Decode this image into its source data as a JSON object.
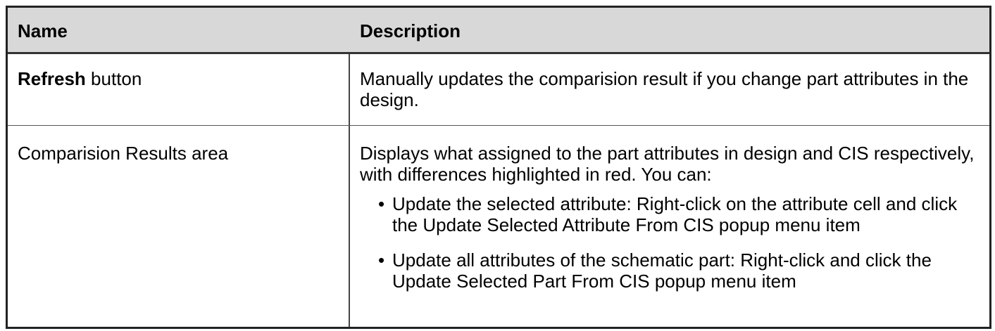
{
  "table": {
    "header": {
      "name": "Name",
      "description": "Description"
    },
    "rows": [
      {
        "name_bold": "Refresh",
        "name_rest": " button",
        "description": "Manually updates the comparision result if you change part attributes in the design."
      },
      {
        "name": "Comparision Results area",
        "description": "Displays what assigned to the part attributes in design and CIS respectively, with differences highlighted in red. You can:",
        "bullets": [
          "Update the selected attribute: Right-click on the attribute cell and click the Update Selected Attribute From CIS popup menu item",
          "Update all attributes of the schematic part: Right-click and click the Update Selected Part From CIS popup menu item"
        ]
      }
    ]
  },
  "icons": {
    "bullet": "•"
  }
}
